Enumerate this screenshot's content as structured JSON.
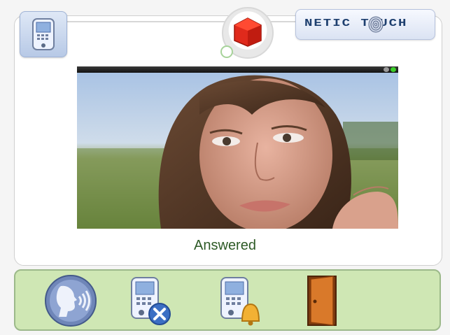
{
  "app": {
    "logo_text": "NETIC T UCH"
  },
  "call": {
    "status": "Answered"
  },
  "toolbar": {
    "buttons": [
      {
        "name": "talk",
        "icon": "speaking-head-icon"
      },
      {
        "name": "hangup",
        "icon": "intercom-cancel-icon"
      },
      {
        "name": "ring",
        "icon": "intercom-bell-icon"
      },
      {
        "name": "open-door",
        "icon": "door-icon"
      }
    ]
  },
  "colors": {
    "status_text": "#2d5a26",
    "bottom_bar": "#cfe7b4",
    "logo_text": "#1e3f6f",
    "home_icon": "#e02a1c"
  }
}
